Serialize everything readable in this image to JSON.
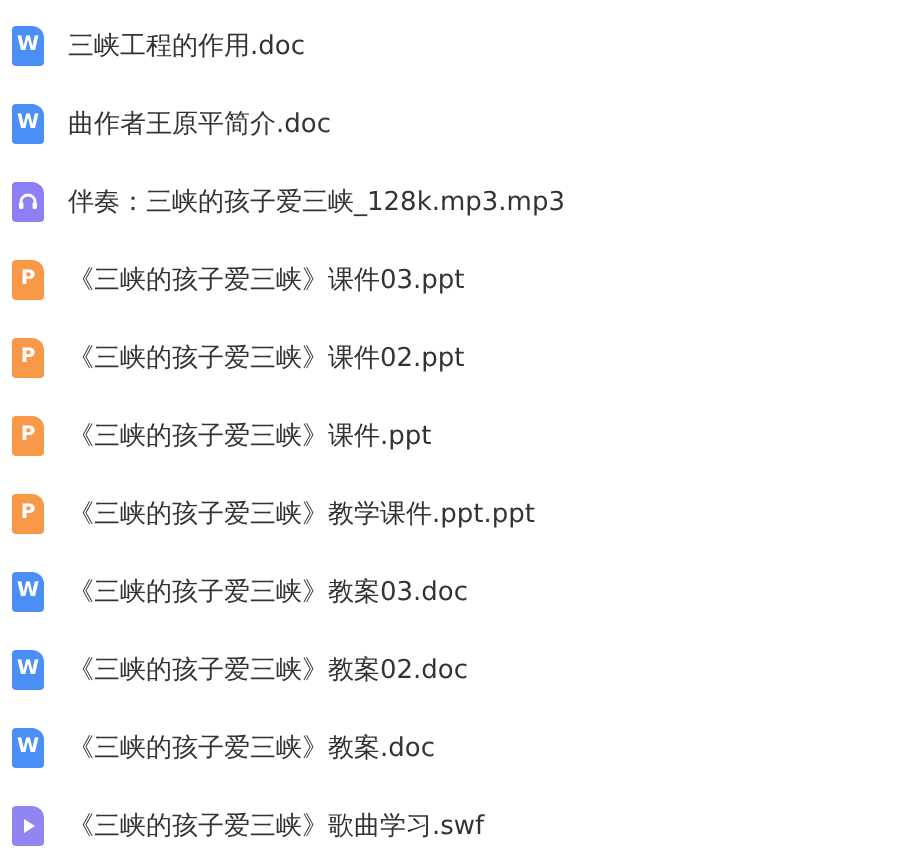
{
  "files": [
    {
      "kind": "doc",
      "icon_letter": "W",
      "name": "三峡工程的作用.doc"
    },
    {
      "kind": "doc",
      "icon_letter": "W",
      "name": "曲作者王原平简介.doc"
    },
    {
      "kind": "audio",
      "name": "伴奏：三峡的孩子爱三峡_128k.mp3.mp3"
    },
    {
      "kind": "ppt",
      "icon_letter": "P",
      "name": "《三峡的孩子爱三峡》课件03.ppt"
    },
    {
      "kind": "ppt",
      "icon_letter": "P",
      "name": "《三峡的孩子爱三峡》课件02.ppt"
    },
    {
      "kind": "ppt",
      "icon_letter": "P",
      "name": "《三峡的孩子爱三峡》课件.ppt"
    },
    {
      "kind": "ppt",
      "icon_letter": "P",
      "name": "《三峡的孩子爱三峡》教学课件.ppt.ppt"
    },
    {
      "kind": "doc",
      "icon_letter": "W",
      "name": "《三峡的孩子爱三峡》教案03.doc"
    },
    {
      "kind": "doc",
      "icon_letter": "W",
      "name": "《三峡的孩子爱三峡》教案02.doc"
    },
    {
      "kind": "doc",
      "icon_letter": "W",
      "name": "《三峡的孩子爱三峡》教案.doc"
    },
    {
      "kind": "video",
      "name": "《三峡的孩子爱三峡》歌曲学习.swf"
    }
  ]
}
